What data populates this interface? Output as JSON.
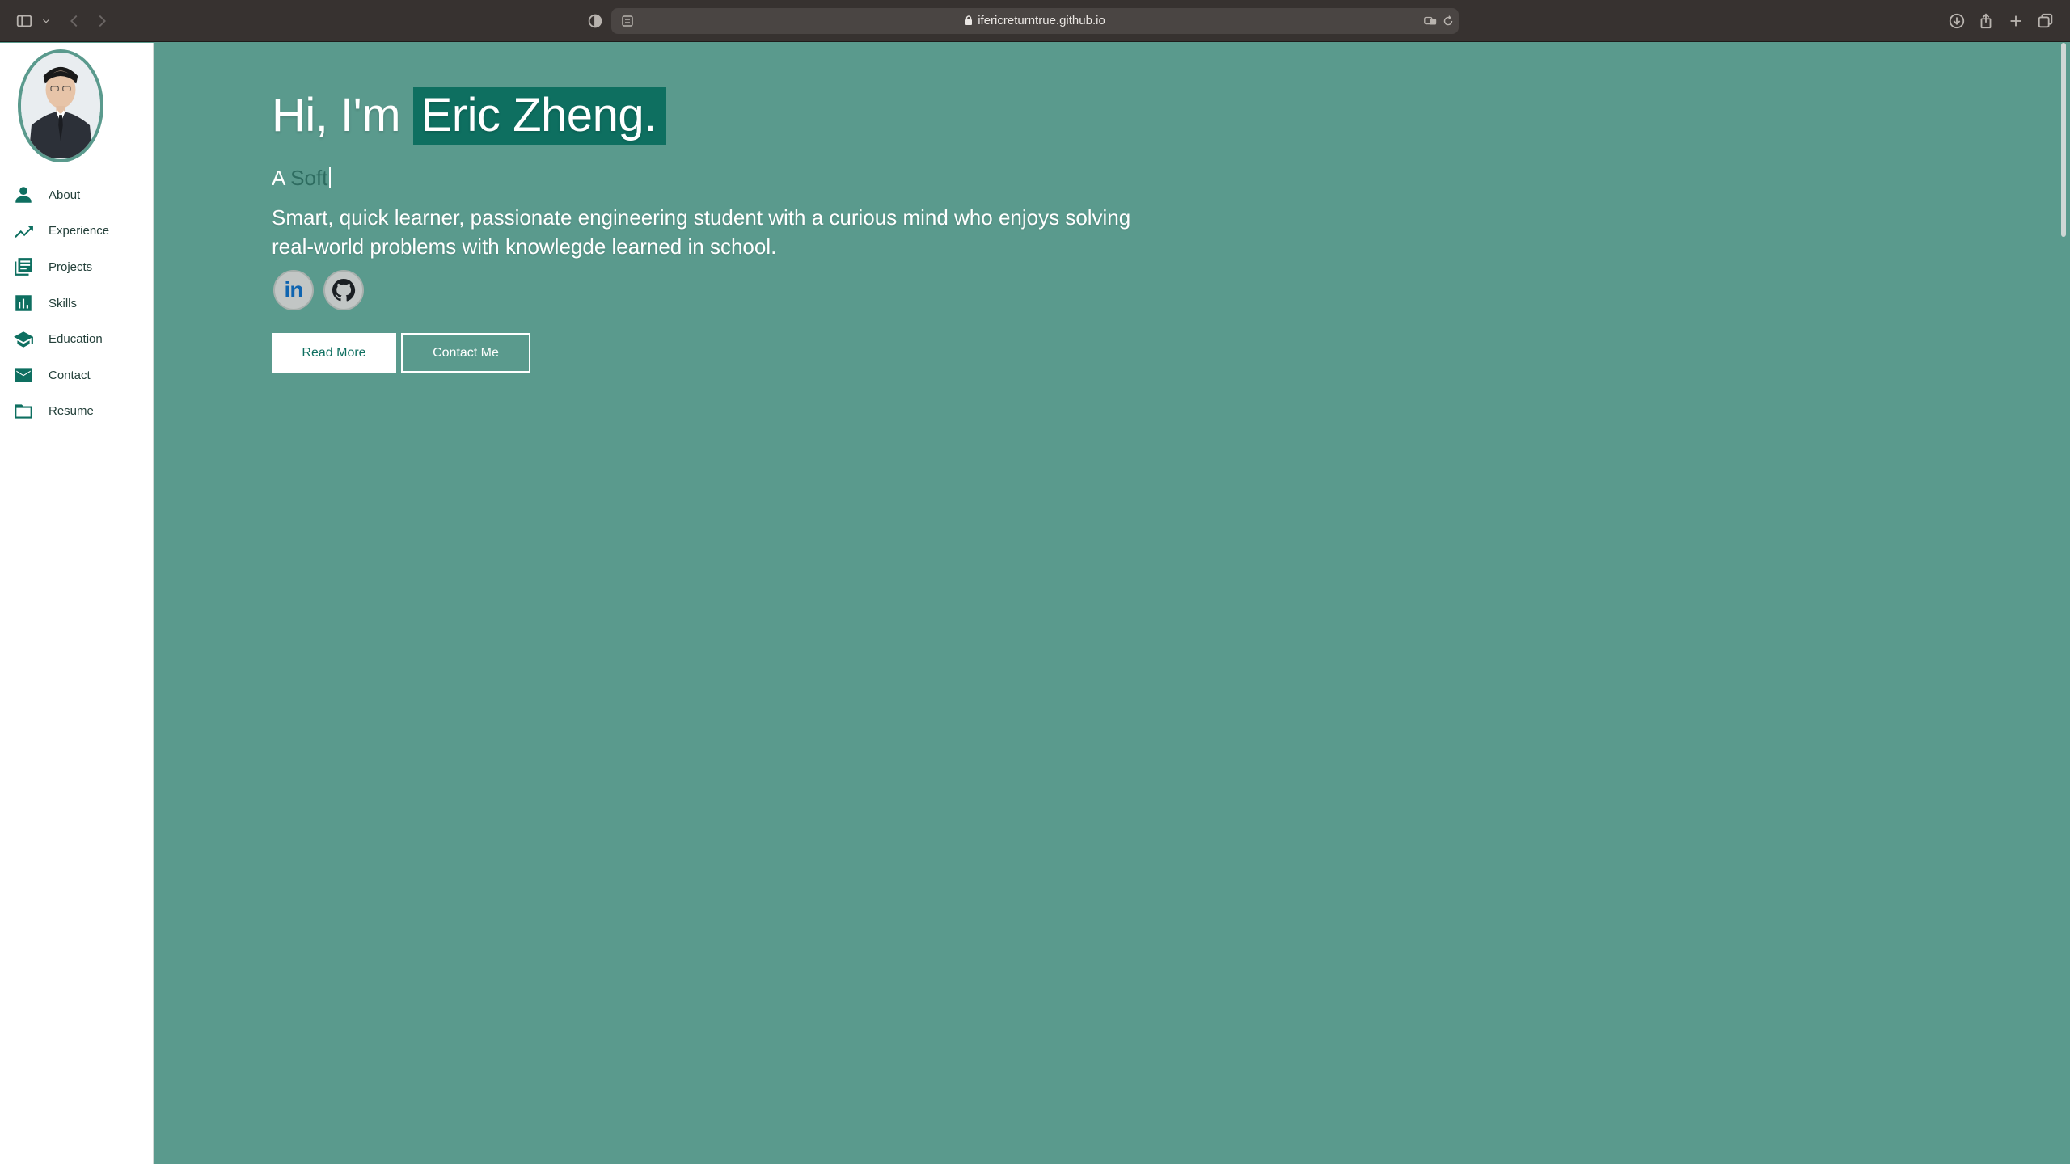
{
  "browser": {
    "url": "ifericreturntrue.github.io"
  },
  "sidebar": {
    "items": [
      {
        "label": "About",
        "icon": "person-icon"
      },
      {
        "label": "Experience",
        "icon": "trending-up-icon"
      },
      {
        "label": "Projects",
        "icon": "list-document-icon"
      },
      {
        "label": "Skills",
        "icon": "bar-chart-icon"
      },
      {
        "label": "Education",
        "icon": "graduation-cap-icon"
      },
      {
        "label": "Contact",
        "icon": "mail-icon"
      },
      {
        "label": "Resume",
        "icon": "folder-icon"
      }
    ]
  },
  "hero": {
    "greeting": "Hi, I'm ",
    "name": "Eric Zheng.",
    "typed_prefix": "A ",
    "typed_word": "Soft",
    "description": "Smart, quick learner, passionate engineering student with a curious mind who enjoys solving real-world problems with knowlegde learned in school.",
    "socials": [
      {
        "label": "in",
        "icon": "linkedin-icon"
      },
      {
        "label": "",
        "icon": "github-icon"
      }
    ],
    "buttons": {
      "primary": "Read More",
      "secondary": "Contact Me"
    }
  },
  "colors": {
    "background": "#5a9a8d",
    "accent": "#0e6f60",
    "sidebar_bg": "#ffffff",
    "chrome_bg": "#373230"
  }
}
